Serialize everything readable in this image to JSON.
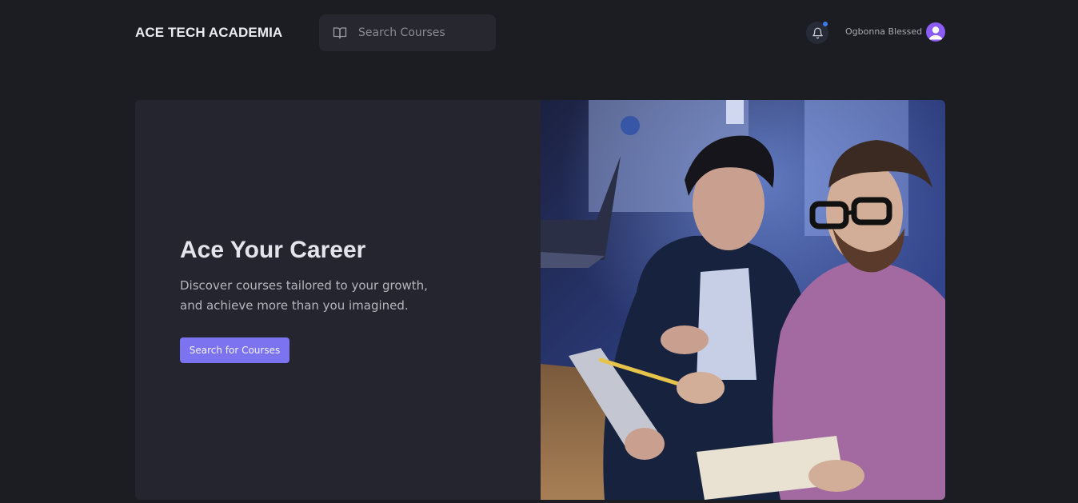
{
  "header": {
    "logo": "ACE TECH ACADEMIA",
    "search": {
      "placeholder": "Search Courses",
      "icon": "book-open-icon"
    },
    "notification_icon": "bell-icon",
    "notification_dot_color": "#3d7bf5",
    "user_name": "Ogbonna Blessed",
    "avatar_icon": "user-avatar-icon"
  },
  "hero": {
    "title": "Ace Your Career",
    "description": "Discover courses tailored to your growth, and achieve more than you imagined.",
    "button_label": "Search for Courses",
    "image_alt": "hero-photo",
    "accent_color": "#7b73f0"
  }
}
